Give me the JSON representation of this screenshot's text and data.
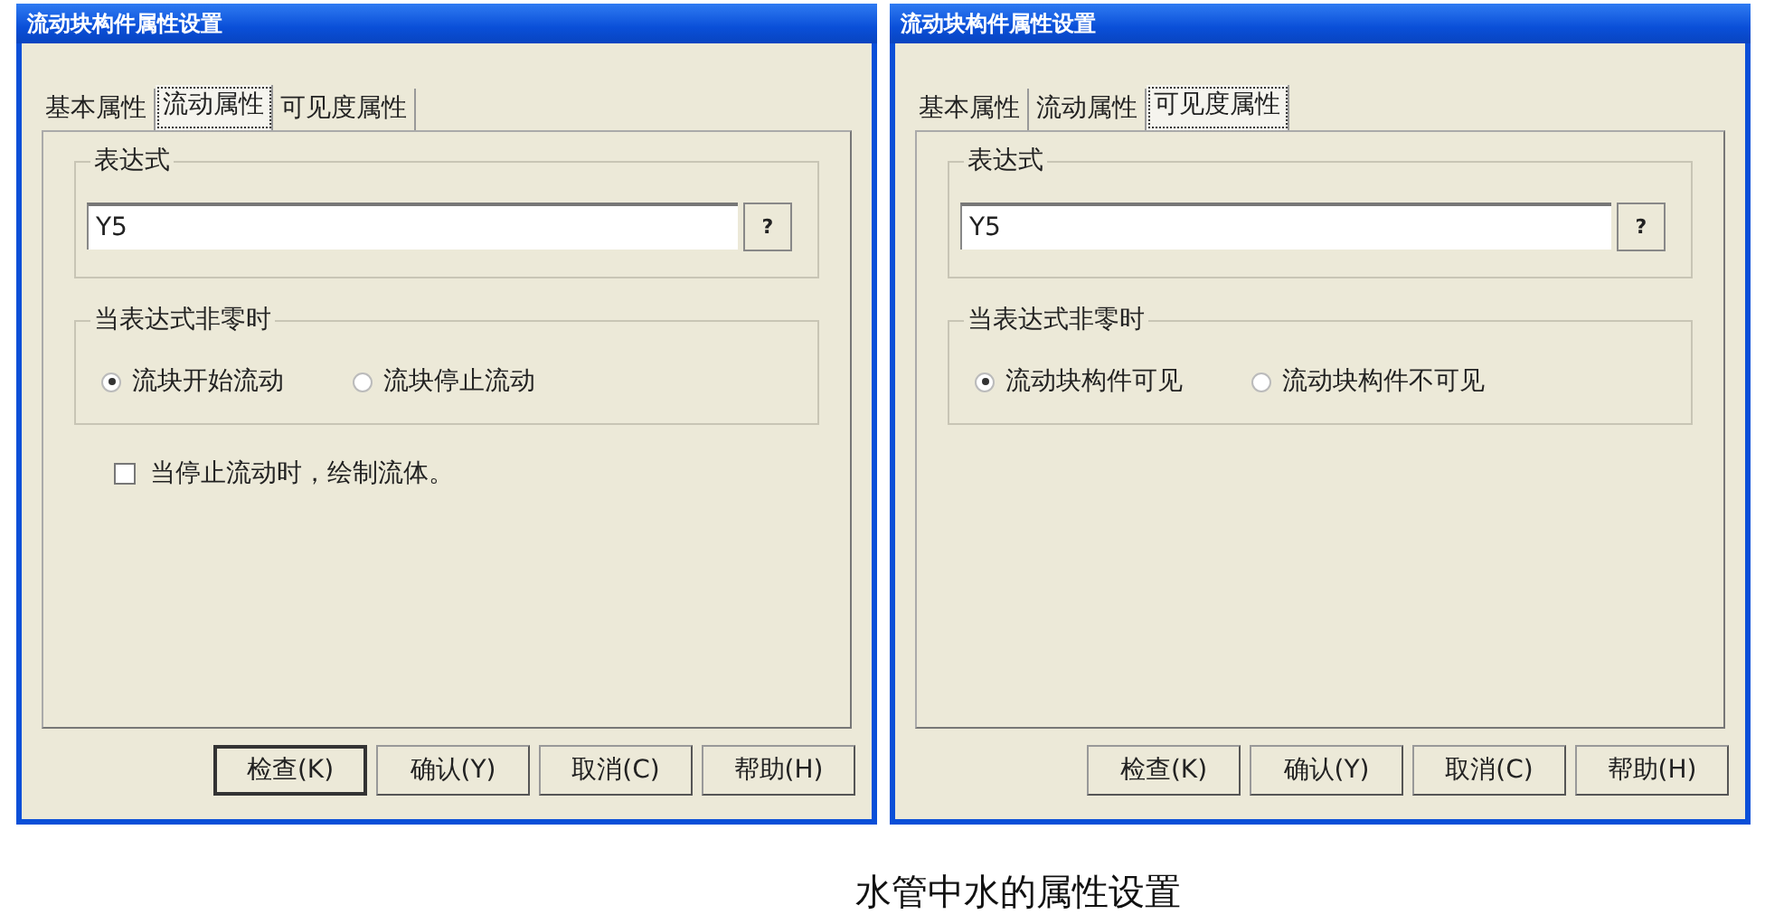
{
  "dialogs": [
    {
      "title": "流动块构件属性设置",
      "tabs": [
        {
          "label": "基本属性",
          "selected": false
        },
        {
          "label": "流动属性",
          "selected": true
        },
        {
          "label": "可见度属性",
          "selected": false
        }
      ],
      "expression_group": {
        "label": "表达式",
        "value": "Y5",
        "button": "?"
      },
      "condition_group": {
        "label": "当表达式非零时",
        "options": [
          {
            "label": "流块开始流动",
            "selected": true
          },
          {
            "label": "流块停止流动",
            "selected": false
          }
        ]
      },
      "checkboxes": [
        {
          "label": "当停止流动时，绘制流体。",
          "checked": false
        }
      ],
      "buttons": [
        {
          "label": "检查(K)",
          "default": true
        },
        {
          "label": "确认(Y)",
          "default": false
        },
        {
          "label": "取消(C)",
          "default": false
        },
        {
          "label": "帮助(H)",
          "default": false
        }
      ]
    },
    {
      "title": "流动块构件属性设置",
      "tabs": [
        {
          "label": "基本属性",
          "selected": false
        },
        {
          "label": "流动属性",
          "selected": false
        },
        {
          "label": "可见度属性",
          "selected": true
        }
      ],
      "expression_group": {
        "label": "表达式",
        "value": "Y5",
        "button": "?"
      },
      "condition_group": {
        "label": "当表达式非零时",
        "options": [
          {
            "label": "流动块构件可见",
            "selected": true
          },
          {
            "label": "流动块构件不可见",
            "selected": false
          }
        ]
      },
      "buttons": [
        {
          "label": "检查(K)",
          "default": false
        },
        {
          "label": "确认(Y)",
          "default": false
        },
        {
          "label": "取消(C)",
          "default": false
        },
        {
          "label": "帮助(H)",
          "default": false
        }
      ]
    }
  ],
  "caption": "水管中水的属性设置"
}
